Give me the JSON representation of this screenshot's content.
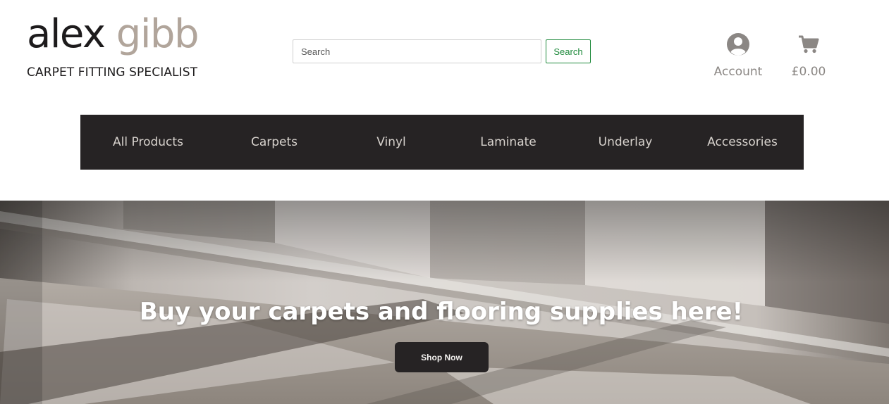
{
  "logo": {
    "first_word": "alex",
    "last_word": "gibb",
    "tagline": "CARPET FITTING SPECIALIST",
    "colors": {
      "dark": "#1d1b1c",
      "accent": "#b1a59b"
    }
  },
  "search": {
    "placeholder": "Search",
    "button_label": "Search",
    "button_color": "#1f8a3c"
  },
  "header": {
    "account": {
      "label": "Account",
      "icon": "user-circle-icon"
    },
    "cart": {
      "total": "£0.00",
      "icon": "shopping-cart-icon"
    }
  },
  "nav": {
    "background": "#262324",
    "items": [
      {
        "label": "All Products"
      },
      {
        "label": "Carpets"
      },
      {
        "label": "Vinyl"
      },
      {
        "label": "Laminate"
      },
      {
        "label": "Underlay"
      },
      {
        "label": "Accessories"
      }
    ]
  },
  "hero": {
    "title": "Buy your carpets and flooring supplies here!",
    "cta_label": "Shop Now"
  }
}
